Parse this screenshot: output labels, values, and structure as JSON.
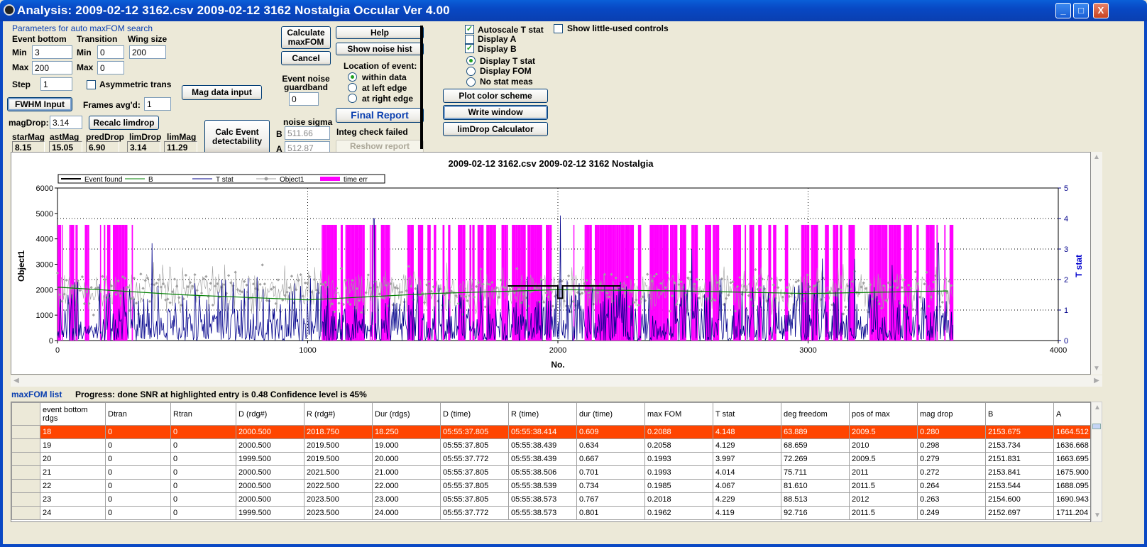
{
  "window": {
    "title": "Analysis: 2009-02-12 3162.csv 2009-02-12 3162 Nostalgia  Occular Ver 4.00",
    "min_label": "_",
    "max_label": "□",
    "close_label": "X"
  },
  "params": {
    "group_title": "Parameters for auto maxFOM search",
    "event_bottom": "Event bottom",
    "transition": "Transition",
    "wing_size": "Wing size",
    "min": "Min",
    "max": "Max",
    "step": "Step",
    "eb_min": "3",
    "eb_max": "200",
    "eb_step": "1",
    "tr_min": "0",
    "tr_max": "0",
    "wing": "200",
    "asym": "Asymmetric trans"
  },
  "buttons": {
    "fwhm": "FWHM Input",
    "mag_data": "Mag data input",
    "recalc": "Recalc limdrop",
    "calc_event": "Calc Event detectability",
    "calc_max1": "Calculate",
    "calc_max2": "maxFOM",
    "cancel": "Cancel",
    "help": "Help",
    "noise_hist": "Show noise hist",
    "final_report": "Final Report",
    "reshow": "Reshow report",
    "plot_color": "Plot color scheme",
    "write_window": "Write window",
    "limdrop_calc": "limDrop Calculator"
  },
  "frames": {
    "label": "Frames avg'd:",
    "value": "1"
  },
  "magdrop": {
    "label": "magDrop:",
    "value": "3.14"
  },
  "mags": {
    "starMag_label": "starMag",
    "starMag": "8.15",
    "astMag_label": "astMag",
    "astMag": "15.05",
    "predDrop_label": "predDrop",
    "predDrop": "6.90",
    "limDrop_label": "limDrop",
    "limDrop": "3.14",
    "limMag_label": "limMag",
    "limMag": "11.29"
  },
  "noise": {
    "guard_label1": "Event noise",
    "guard_label2": "guardband",
    "guard_value": "0",
    "sigma_label": "noise sigma",
    "b_label": "B",
    "b_value": "511.66",
    "a_label": "A",
    "a_value": "512.87"
  },
  "location": {
    "label": "Location of event:",
    "within": "within data",
    "left": "at left edge",
    "right": "at right edge"
  },
  "integ": "Integ check failed",
  "options": {
    "autoscale": "Autoscale T stat",
    "display_a": "Display A",
    "display_b": "Display B",
    "display_t": "Display T stat",
    "display_fom": "Display FOM",
    "no_stat": "No stat meas",
    "little_used": "Show little-used controls"
  },
  "chart_data": {
    "type": "line",
    "title": "2009-02-12 3162.csv 2009-02-12 3162 Nostalgia",
    "xlabel": "No.",
    "ylabel": "Object1",
    "y2label": "T stat",
    "xlim": [
      0,
      4000
    ],
    "ylim": [
      0,
      6000
    ],
    "y2lim": [
      0,
      5
    ],
    "xticks": [
      "0",
      "1000",
      "2000",
      "3000",
      "4000"
    ],
    "yticks": [
      "0",
      "1000",
      "2000",
      "3000",
      "4000",
      "5000",
      "6000"
    ],
    "y2ticks": [
      "0",
      "1",
      "2",
      "3",
      "4",
      "5"
    ],
    "legend": [
      "Event found",
      "B",
      "T stat",
      "Object1",
      "time err"
    ],
    "legend_placement": "top-left",
    "grid": true,
    "event_found": {
      "x": [
        1800,
        2000,
        2000,
        2019,
        2019,
        2250
      ],
      "y": [
        2150,
        2150,
        1664,
        1664,
        2150,
        2150
      ]
    },
    "b_baseline": {
      "x": [
        0,
        500,
        1000,
        1500,
        2000,
        2500,
        3000,
        3560
      ],
      "y": [
        2100,
        1800,
        1600,
        1850,
        2000,
        1950,
        1850,
        1950
      ]
    },
    "object1_range": {
      "x_start": 0,
      "x_end": 3580,
      "mean": 1950,
      "spread": 800
    },
    "time_err": {
      "x_start": 0,
      "x_end": 3580,
      "level": 4550
    },
    "tstat_peaks": [
      {
        "x": 1265,
        "y": 4.0
      },
      {
        "x": 2010,
        "y": 4.1
      },
      {
        "x": 3520,
        "y": 3.2
      }
    ],
    "colors": {
      "event_found": "#000000",
      "b": "#008000",
      "tstat": "#00008b",
      "object1": "#a0a0a0",
      "time_err": "#ff00ff"
    }
  },
  "maxfom": {
    "label": "maxFOM list",
    "progress": "Progress: done  SNR at highlighted entry is 0.48   Confidence level is 45%"
  },
  "table": {
    "headers": [
      "event bottom rdgs",
      "Dtran",
      "Rtran",
      "D (rdg#)",
      "R (rdg#)",
      "Dur (rdgs)",
      "D (time)",
      "R (time)",
      "dur (time)",
      "max FOM",
      "T stat",
      "deg freedom",
      "pos of max",
      "mag drop",
      "B",
      "A"
    ],
    "rows": [
      [
        "18",
        "0",
        "0",
        "2000.500",
        "2018.750",
        "18.250",
        "05:55:37.805",
        "05:55:38.414",
        "0.609",
        "0.2088",
        "4.148",
        "63.889",
        "2009.5",
        "0.280",
        "2153.675",
        "1664.512"
      ],
      [
        "19",
        "0",
        "0",
        "2000.500",
        "2019.500",
        "19.000",
        "05:55:37.805",
        "05:55:38.439",
        "0.634",
        "0.2058",
        "4.129",
        "68.659",
        "2010",
        "0.298",
        "2153.734",
        "1636.668"
      ],
      [
        "20",
        "0",
        "0",
        "1999.500",
        "2019.500",
        "20.000",
        "05:55:37.772",
        "05:55:38.439",
        "0.667",
        "0.1993",
        "3.997",
        "72.269",
        "2009.5",
        "0.279",
        "2151.831",
        "1663.695"
      ],
      [
        "21",
        "0",
        "0",
        "2000.500",
        "2021.500",
        "21.000",
        "05:55:37.805",
        "05:55:38.506",
        "0.701",
        "0.1993",
        "4.014",
        "75.711",
        "2011",
        "0.272",
        "2153.841",
        "1675.900"
      ],
      [
        "22",
        "0",
        "0",
        "2000.500",
        "2022.500",
        "22.000",
        "05:55:37.805",
        "05:55:38.539",
        "0.734",
        "0.1985",
        "4.067",
        "81.610",
        "2011.5",
        "0.264",
        "2153.544",
        "1688.095"
      ],
      [
        "23",
        "0",
        "0",
        "2000.500",
        "2023.500",
        "23.000",
        "05:55:37.805",
        "05:55:38.573",
        "0.767",
        "0.2018",
        "4.229",
        "88.513",
        "2012",
        "0.263",
        "2154.600",
        "1690.943"
      ],
      [
        "24",
        "0",
        "0",
        "1999.500",
        "2023.500",
        "24.000",
        "05:55:37.772",
        "05:55:38.573",
        "0.801",
        "0.1962",
        "4.119",
        "92.716",
        "2011.5",
        "0.249",
        "2152.697",
        "1711.204"
      ]
    ]
  }
}
